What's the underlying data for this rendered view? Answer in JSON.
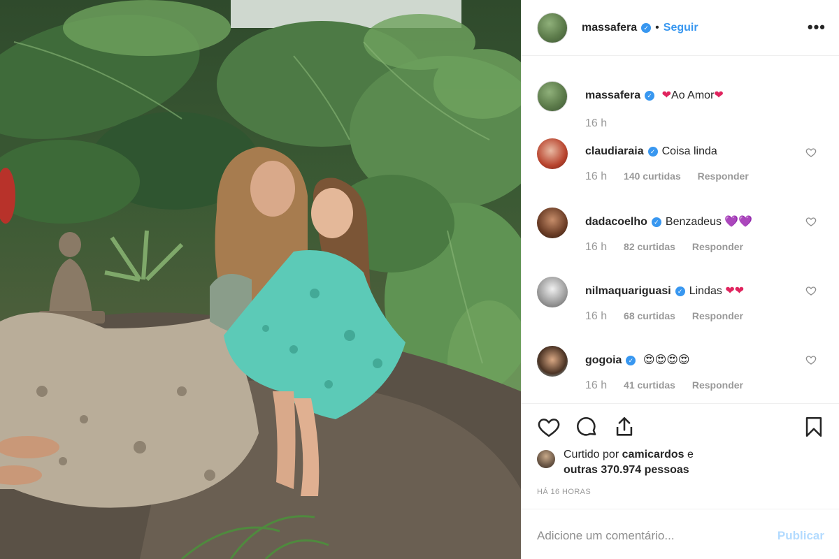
{
  "post": {
    "username": "massafera",
    "follow_label": "Seguir",
    "more_label": "•••",
    "separator": "•",
    "verified_glyph": "✓"
  },
  "caption": {
    "username": "massafera",
    "heart_left": "❤",
    "text": "Ao Amor",
    "heart_right": "❤",
    "time": "16 h"
  },
  "comments": [
    {
      "username": "claudiaraia",
      "text": "Coisa linda",
      "time": "16 h",
      "likes": "140 curtidas",
      "reply": "Responder",
      "avatar_color": "#b8442e"
    },
    {
      "username": "dadacoelho",
      "text": "Benzadeus",
      "emoji": "💜💜",
      "time": "16 h",
      "likes": "82 curtidas",
      "reply": "Responder",
      "avatar_color": "#6b3d26"
    },
    {
      "username": "nilmaquariguasi",
      "text": "Lindas",
      "emoji": "❤❤",
      "time": "16 h",
      "likes": "68 curtidas",
      "reply": "Responder",
      "avatar_color": "#8a8a8a"
    },
    {
      "username": "gogoia",
      "text": "",
      "emoji": "😍😍😍😍",
      "time": "16 h",
      "likes": "41 curtidas",
      "reply": "Responder",
      "avatar_color": "#4b3324"
    }
  ],
  "likes": {
    "prefix": "Curtido por ",
    "user": "camicardos",
    "middle": " e",
    "others": "outras 370.974 pessoas"
  },
  "time_ago": "HÁ 16 HORAS",
  "comment_box": {
    "placeholder": "Adicione um comentário...",
    "publish_label": "Publicar"
  },
  "colors": {
    "accent": "#3897f0",
    "muted": "#999999",
    "publish_disabled": "#b3dbff"
  },
  "icons": [
    "heart-icon",
    "comment-icon",
    "share-icon",
    "bookmark-icon",
    "verified-badge-icon",
    "more-icon"
  ]
}
